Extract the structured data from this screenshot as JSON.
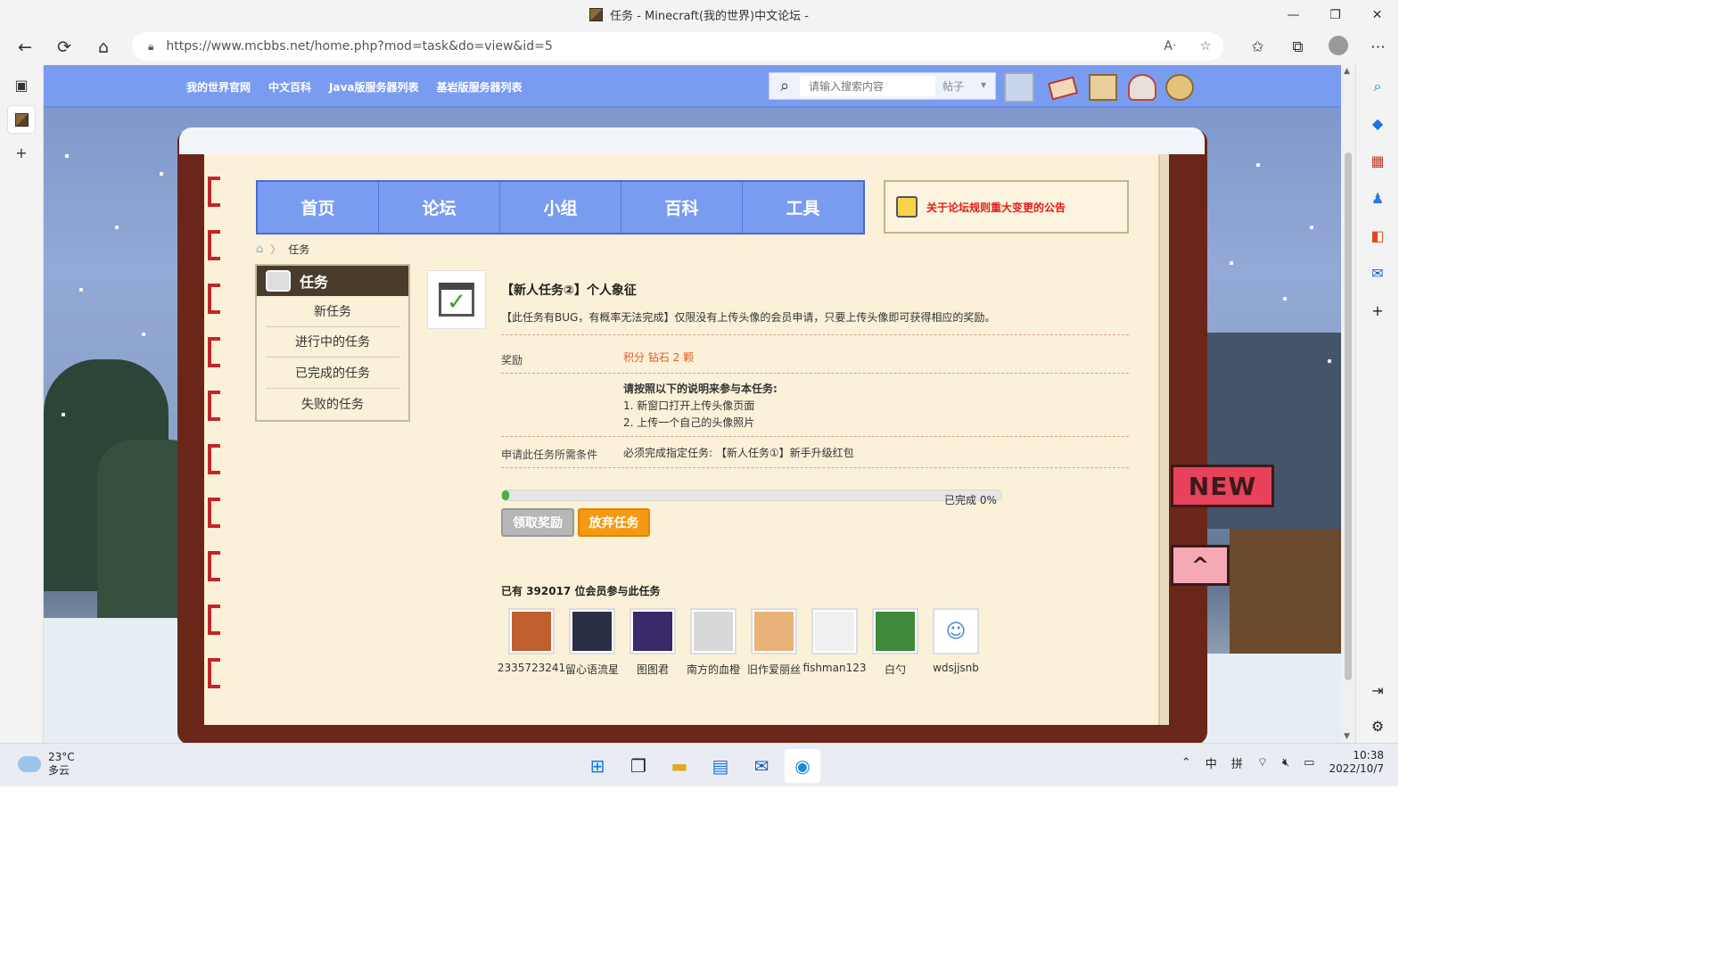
{
  "browser": {
    "title": "任务 - Minecraft(我的世界)中文论坛 -",
    "url": "https://www.mcbbs.net/home.php?mod=task&do=view&id=5"
  },
  "site": {
    "links": [
      "我的世界官网",
      "中文百科",
      "Java版服务器列表",
      "基岩版服务器列表"
    ],
    "search_placeholder": "请输入搜索内容",
    "search_scope": "帖子"
  },
  "main_tabs": [
    "首页",
    "论坛",
    "小组",
    "百科",
    "工具"
  ],
  "notice": "关于论坛规则重大变更的公告",
  "breadcrumb": "任务",
  "task_menu": {
    "title": "任务",
    "items": [
      "新任务",
      "进行中的任务",
      "已完成的任务",
      "失败的任务"
    ]
  },
  "task": {
    "title": "【新人任务②】个人象征",
    "description": "【此任务有BUG，有概率无法完成】仅限没有上传头像的会员申请，只要上传头像即可获得相应的奖励。",
    "reward_label": "奖励",
    "reward_value": "积分 钻石 2 颗",
    "instructions_heading": "请按照以下的说明来参与本任务:",
    "instructions": [
      "1. 新窗口打开上传头像页面",
      "2. 上传一个自己的头像照片"
    ],
    "requirement_label": "申请此任务所需条件",
    "requirement_value": "必须完成指定任务: 【新人任务①】新手升级红包",
    "progress_percent": 0,
    "progress_text": "已完成 0%",
    "claim_button": "领取奖励",
    "abandon_button": "放弃任务",
    "participants_text": "已有 392017 位会员参与此任务"
  },
  "members": [
    {
      "name": "2335723241",
      "color": "#c06030"
    },
    {
      "name": "留心语流星",
      "color": "#2a2f45"
    },
    {
      "name": "图图君",
      "color": "#3a2a6a"
    },
    {
      "name": "南方的血橙",
      "color": "#d8d8d8"
    },
    {
      "name": "旧作爱丽丝",
      "color": "#e9b27a"
    },
    {
      "name": "fishman123",
      "color": "#f0f0f0"
    },
    {
      "name": "白勺",
      "color": "#3f8a3a"
    },
    {
      "name": "wdsjjsnb",
      "color": "#ffffff"
    }
  ],
  "ribbons": {
    "new": "NEW",
    "up": "^"
  },
  "taskbar": {
    "temperature": "23°C",
    "weather": "多云",
    "ime1": "中",
    "ime2": "拼",
    "time": "10:38",
    "date": "2022/10/7"
  }
}
